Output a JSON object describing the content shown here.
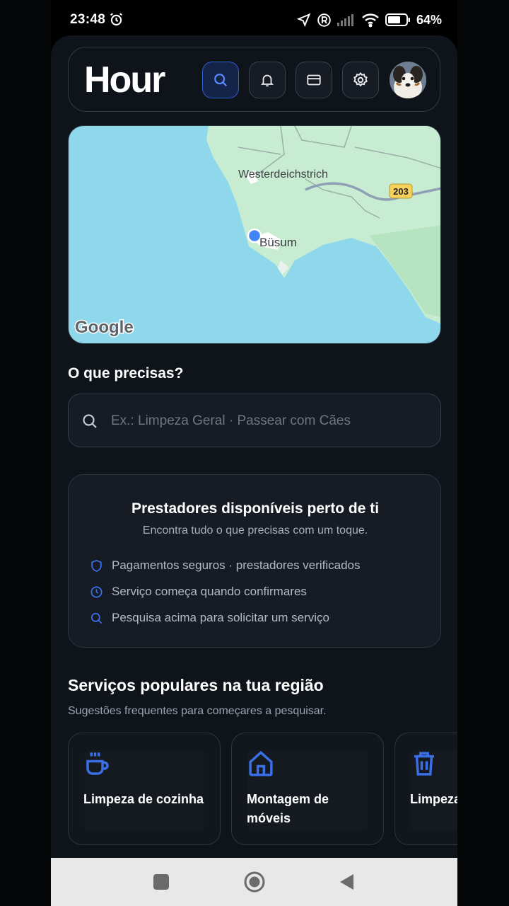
{
  "status_bar": {
    "time": "23:48",
    "battery": "64%",
    "icons": [
      "alarm-icon",
      "location-arrow-icon",
      "registered-icon",
      "signal-icon",
      "wifi-icon",
      "battery-icon"
    ]
  },
  "header": {
    "logo": "Hour",
    "buttons": [
      "search-icon",
      "bell-icon",
      "card-icon",
      "gear-icon"
    ],
    "avatar": "user-avatar"
  },
  "map": {
    "town_label": "Westerdeichstrich",
    "location_label": "Büsum",
    "road_badge": "203",
    "provider": "Google"
  },
  "search_section": {
    "title": "O que precisas?",
    "placeholder": "Ex.: Limpeza Geral · Passear com Cães"
  },
  "info_card": {
    "title": "Prestadores disponíveis perto de ti",
    "subtitle": "Encontra tudo o que precisas com um toque.",
    "features": [
      {
        "icon": "shield-icon",
        "text": "Pagamentos seguros · prestadores verificados"
      },
      {
        "icon": "clock-icon",
        "text": "Serviço começa quando confirmares"
      },
      {
        "icon": "search-icon",
        "text": "Pesquisa acima para solicitar um serviço"
      }
    ]
  },
  "popular": {
    "title": "Serviços populares na tua região",
    "subtitle": "Sugestões frequentes para começares a pesquisar.",
    "cards": [
      {
        "icon": "coffee-cup-icon",
        "label": "Limpeza de cozinha"
      },
      {
        "icon": "home-icon",
        "label": "Montagem de\nmóveis"
      },
      {
        "icon": "trash-icon",
        "label": "Limpeza"
      }
    ]
  },
  "colors": {
    "accent": "#3b6fe6",
    "background": "#0f131a",
    "surface": "#171c24"
  }
}
